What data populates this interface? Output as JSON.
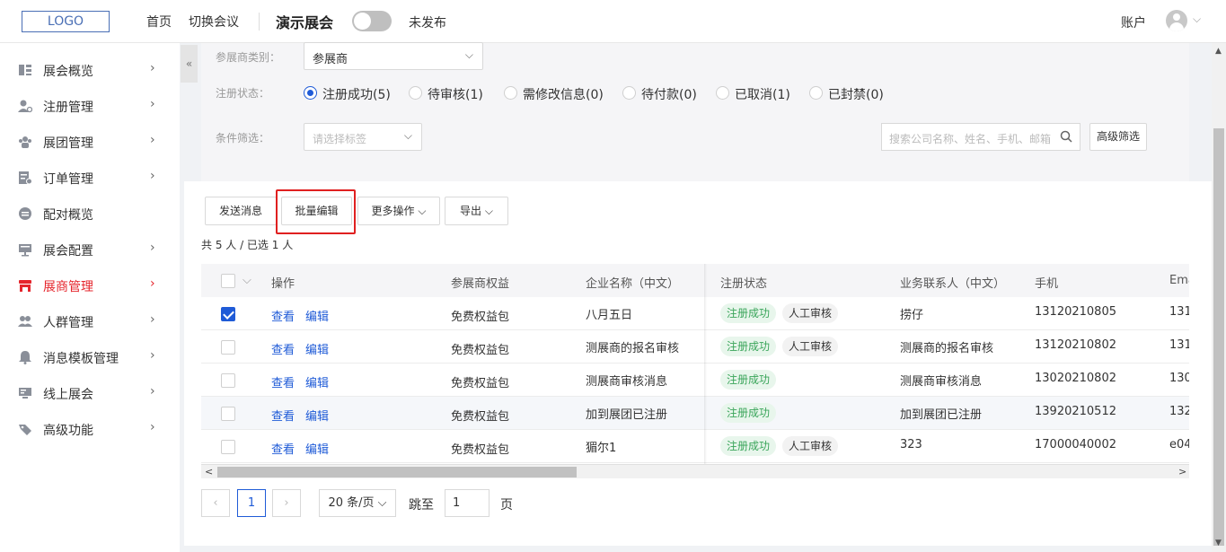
{
  "header": {
    "logo": "LOGO",
    "nav": [
      "首页",
      "切换会议"
    ],
    "expo_name": "演示展会",
    "publish_status": "未发布",
    "account": "账户"
  },
  "sidebar": {
    "collapse_label": "«",
    "items": [
      {
        "label": "展会概览",
        "icon": "dashboard-icon",
        "has_children": true
      },
      {
        "label": "注册管理",
        "icon": "user-register-icon",
        "has_children": true
      },
      {
        "label": "展团管理",
        "icon": "group-icon",
        "has_children": true
      },
      {
        "label": "订单管理",
        "icon": "order-icon",
        "has_children": true
      },
      {
        "label": "配对概览",
        "icon": "match-icon",
        "has_children": false
      },
      {
        "label": "展会配置",
        "icon": "config-icon",
        "has_children": true
      },
      {
        "label": "展商管理",
        "icon": "exhibitor-icon",
        "has_children": true,
        "active": true
      },
      {
        "label": "人群管理",
        "icon": "people-icon",
        "has_children": true
      },
      {
        "label": "消息模板管理",
        "icon": "bell-icon",
        "has_children": true
      },
      {
        "label": "线上展会",
        "icon": "monitor-icon",
        "has_children": true
      },
      {
        "label": "高级功能",
        "icon": "tag-icon",
        "has_children": true
      }
    ]
  },
  "filters": {
    "type_label": "参展商类别：",
    "type_value": "参展商",
    "status_label": "注册状态：",
    "status_options": [
      {
        "label": "注册成功(5)",
        "checked": true
      },
      {
        "label": "待审核(1)",
        "checked": false
      },
      {
        "label": "需修改信息(0)",
        "checked": false
      },
      {
        "label": "待付款(0)",
        "checked": false
      },
      {
        "label": "已取消(1)",
        "checked": false
      },
      {
        "label": "已封禁(0)",
        "checked": false
      }
    ],
    "condition_label": "条件筛选：",
    "tag_placeholder": "请选择标签",
    "search_placeholder": "搜索公司名称、姓名、手机、邮箱",
    "advanced_button": "高级筛选"
  },
  "toolbar": {
    "send_message": "发送消息",
    "batch_edit": "批量编辑",
    "more_actions": "更多操作",
    "export": "导出"
  },
  "summary": "共 5 人 / 已选 1 人",
  "table": {
    "columns": [
      "操作",
      "参展商权益",
      "企业名称（中文）",
      "注册状态",
      "业务联系人（中文）",
      "手机",
      "Ema"
    ],
    "view_label": "查看",
    "edit_label": "编辑",
    "rows": [
      {
        "checked": true,
        "benefit": "免费权益包",
        "company": "八月五日",
        "status": "注册成功",
        "review": "人工审核",
        "contact": "捞仔",
        "phone": "13120210805",
        "email": "131"
      },
      {
        "checked": false,
        "benefit": "免费权益包",
        "company": "测展商的报名审核",
        "status": "注册成功",
        "review": "人工审核",
        "contact": "测展商的报名审核",
        "phone": "13120210802",
        "email": "131"
      },
      {
        "checked": false,
        "benefit": "免费权益包",
        "company": "测展商审核消息",
        "status": "注册成功",
        "review": "",
        "contact": "测展商审核消息",
        "phone": "13020210802",
        "email": "130"
      },
      {
        "checked": false,
        "benefit": "免费权益包",
        "company": "加到展团已注册",
        "status": "注册成功",
        "review": "",
        "contact": "加到展团已注册",
        "phone": "13920210512",
        "email": "132"
      },
      {
        "checked": false,
        "benefit": "免费权益包",
        "company": "猸尔1",
        "status": "注册成功",
        "review": "人工审核",
        "contact": "323",
        "phone": "17000040002",
        "email": "e04"
      }
    ]
  },
  "pagination": {
    "prev": "‹",
    "current": "1",
    "next": "›",
    "page_size": "20 条/页",
    "jump_label": "跳至",
    "jump_value": "1",
    "page_unit": "页"
  }
}
